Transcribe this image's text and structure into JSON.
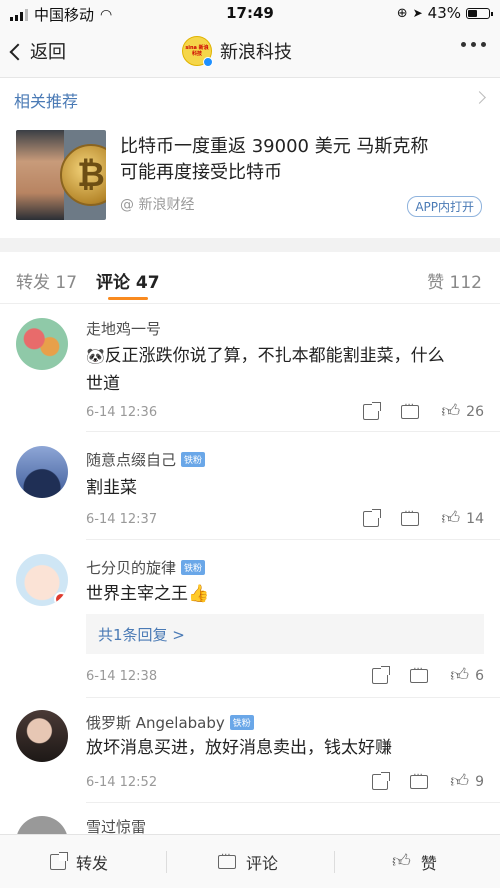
{
  "status": {
    "carrier": "中国移动",
    "time": "17:49",
    "battery": "43%"
  },
  "nav": {
    "back_label": "返回",
    "title": "新浪科技",
    "logo_text": "sina 新浪科技"
  },
  "related": {
    "label": "相关推荐"
  },
  "article": {
    "title_line1": "比特币一度重返 39000 美元 马斯克称",
    "title_line2": "可能再度接受比特币",
    "source": "@ 新浪财经",
    "app_button": "APP内打开"
  },
  "tabs": {
    "reposts": "转发 17",
    "comments": "评论 47",
    "likes": "赞 112"
  },
  "comments": [
    {
      "user": "走地鸡一号",
      "badge": "",
      "text_line1": "反正涨跌你说了算，不扎本都能割韭菜，什么",
      "text_line2": "世道",
      "time": "6-14 12:36",
      "likes": "26"
    },
    {
      "user": "随意点缀自己",
      "badge": "铁粉",
      "text": "割韭菜",
      "time": "6-14 12:37",
      "likes": "14"
    },
    {
      "user": "七分贝的旋律",
      "badge": "铁粉",
      "text": "世界主宰之王",
      "reply": "共1条回复 >",
      "time": "6-14 12:38",
      "likes": "6"
    },
    {
      "user": "俄罗斯 Angelababy",
      "badge": "铁粉",
      "text": "放坏消息买进，放好消息卖出，钱太好赚",
      "time": "6-14 12:52",
      "likes": "9"
    },
    {
      "user": "雪过惊雷"
    }
  ],
  "bottom": {
    "repost": "转发",
    "comment": "评论",
    "like": "赞"
  }
}
